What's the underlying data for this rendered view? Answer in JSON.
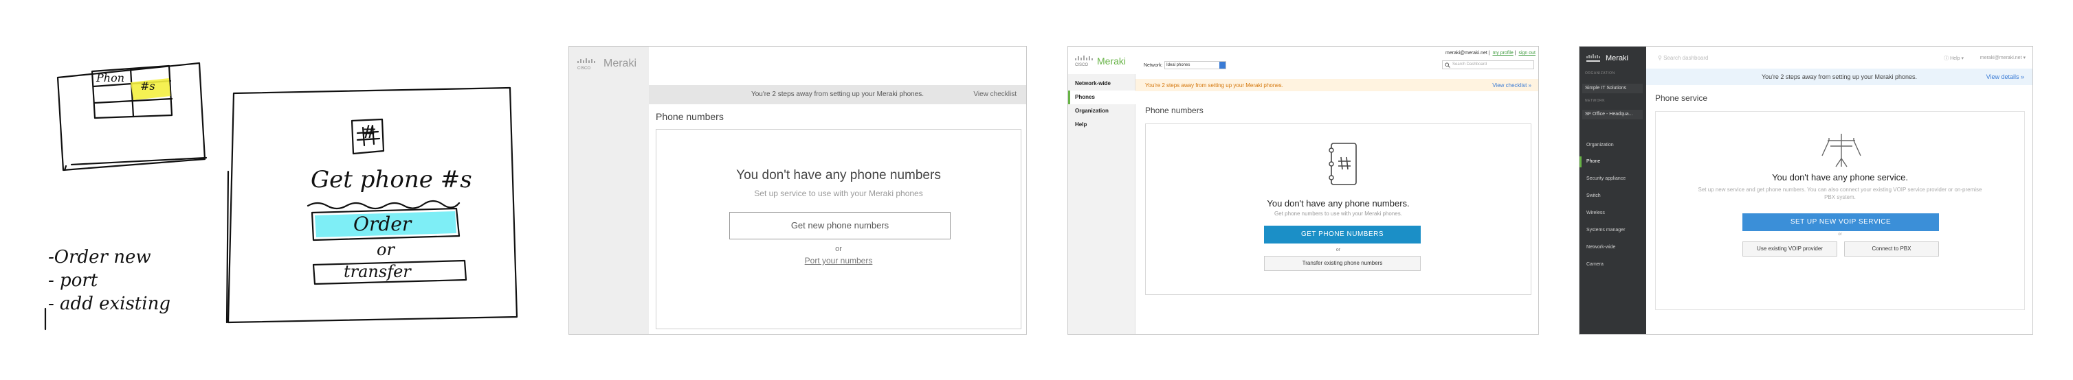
{
  "sketch": {
    "mini_label": "Phon",
    "mini_highlight": "#s",
    "icon_glyph": "#",
    "heading": "Get phone #s",
    "order_label": "Order",
    "or_label": "or",
    "transfer_label": "transfer",
    "list": [
      "-Order new",
      "- port",
      "- add existing"
    ],
    "highlight_color": "#7eeef6"
  },
  "mock1": {
    "brand": "Meraki",
    "cisco": "CISCO",
    "banner_text": "You're 2 steps away from setting up your Meraki phones.",
    "banner_link": "View checklist",
    "page_title": "Phone numbers",
    "empty_heading": "You don't have any phone numbers",
    "empty_sub": "Set up service to use with your Meraki phones",
    "primary_button": "Get new phone numbers",
    "or_text": "or",
    "port_link": "Port your numbers"
  },
  "mock2": {
    "brand": "Meraki",
    "cisco": "CISCO",
    "network_label": "Network:",
    "network_value": "Ideal phones",
    "user_email": "meraki@meraki.net",
    "my_profile": "my profile",
    "sign_out": "sign out",
    "search_placeholder": "Search Dashboard",
    "nav": [
      "Network-wide",
      "Phones",
      "Organization",
      "Help"
    ],
    "banner_text": "You're 2 steps away from setting up your Meraki phones.",
    "banner_link": "View checklist »",
    "page_title": "Phone numbers",
    "empty_heading": "You don't have any phone numbers.",
    "empty_sub": "Get phone numbers to use with your Meraki phones.",
    "primary_button": "GET PHONE NUMBERS",
    "or_text": "or",
    "secondary_button": "Transfer existing phone numbers",
    "accent_color": "#1b8fc7"
  },
  "mock3": {
    "brand": "Meraki",
    "section_org": "ORGANIZATION",
    "org_value": "Simple IT Solutions",
    "section_network": "NETWORK",
    "network_value": "SF Office - Headqua...",
    "nav": [
      "Organization",
      "Phone",
      "Security appliance",
      "Switch",
      "Wireless",
      "Systems manager",
      "Network-wide",
      "Camera"
    ],
    "search_placeholder": "Search dashboard",
    "help": "Help",
    "user": "meraki@meraki.net",
    "banner_text": "You're 2 steps away from setting up your Meraki phones.",
    "banner_link": "View details »",
    "page_title": "Phone service",
    "empty_heading": "You don't have any phone service.",
    "empty_sub": "Set up new service and get phone numbers. You can also connect your existing VOIP service provider or on-premise PBX system.",
    "primary_button": "SET UP NEW VOIP SERVICE",
    "or_text": "or",
    "voip_button": "Use existing VOIP provider",
    "pbx_button": "Connect to PBX",
    "accent_color": "#3b8fd8"
  }
}
